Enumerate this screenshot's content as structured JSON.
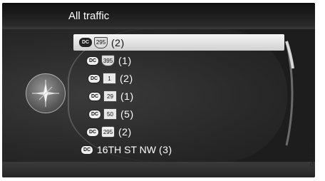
{
  "title": "All traffic",
  "rows": [
    {
      "badge": "DC",
      "shield": "295",
      "shield_type": "interstate",
      "count": "(2)",
      "selected": true
    },
    {
      "badge": "DC",
      "shield": "395",
      "shield_type": "interstate",
      "count": "(1)"
    },
    {
      "badge": "DC",
      "shield": "1",
      "shield_type": "us",
      "count": "(2)"
    },
    {
      "badge": "DC",
      "shield": "29",
      "shield_type": "us",
      "count": "(1)"
    },
    {
      "badge": "DC",
      "shield": "50",
      "shield_type": "us",
      "count": "(5)"
    },
    {
      "badge": "DC",
      "shield": "295",
      "shield_type": "md",
      "count": "(2)"
    },
    {
      "badge": "DC",
      "name": "16TH ST NW",
      "count": "(3)"
    }
  ],
  "image_code": "G051276",
  "icons": {
    "compass": "compass-icon",
    "scroll": "scroll-indicator"
  }
}
